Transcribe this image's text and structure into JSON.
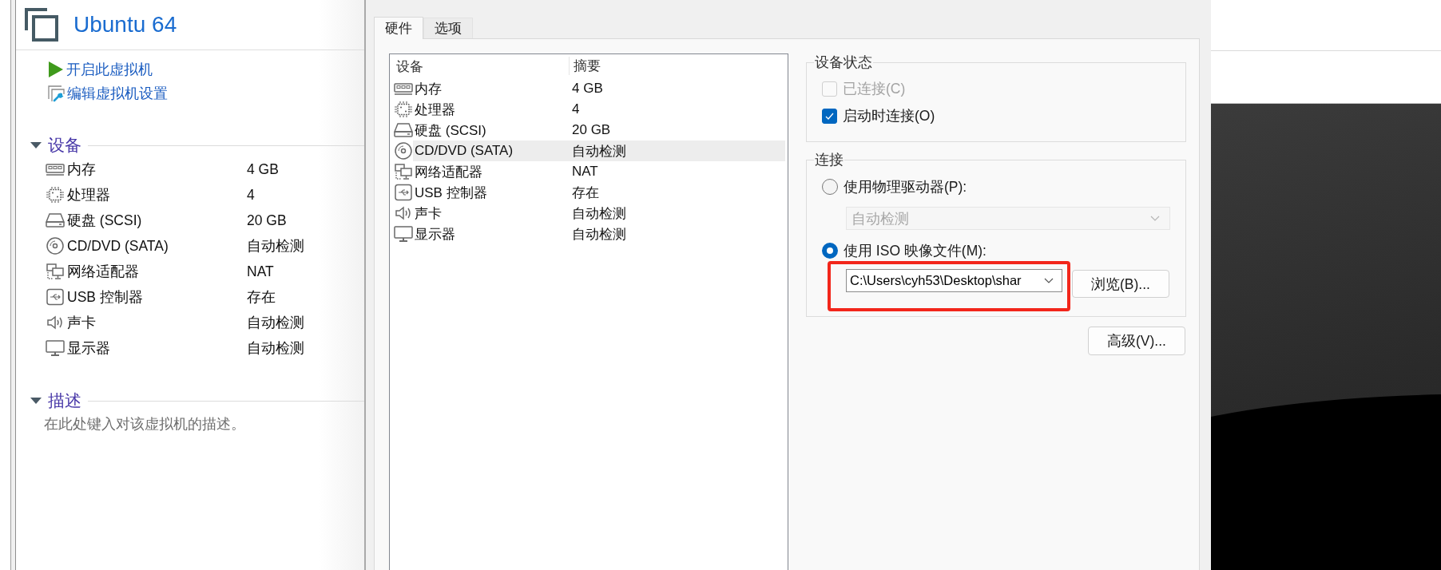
{
  "vm_panel": {
    "title": "Ubuntu 64",
    "actions": [
      {
        "kind": "power_on",
        "label": "开启此虚拟机"
      },
      {
        "kind": "edit_settings",
        "label": "编辑虚拟机设置"
      }
    ],
    "devices": {
      "title": "设备",
      "expanded": true,
      "items": [
        {
          "kind": "memory",
          "name": "内存",
          "summary": "4 GB"
        },
        {
          "kind": "processor",
          "name": "处理器",
          "summary": "4"
        },
        {
          "kind": "hard_disk",
          "name": "硬盘 (SCSI)",
          "summary": "20 GB"
        },
        {
          "kind": "cd_dvd",
          "name": "CD/DVD (SATA)",
          "summary": "自动检测"
        },
        {
          "kind": "network",
          "name": "网络适配器",
          "summary": "NAT"
        },
        {
          "kind": "usb",
          "name": "USB 控制器",
          "summary": "存在"
        },
        {
          "kind": "sound",
          "name": "声卡",
          "summary": "自动检测"
        },
        {
          "kind": "display",
          "name": "显示器",
          "summary": "自动检测"
        }
      ]
    },
    "description": {
      "title": "描述",
      "expanded": true,
      "hint": "在此处键入对该虚拟机的描述。"
    }
  },
  "settings_dialog": {
    "tabs": [
      {
        "label": "硬件",
        "selected": true
      },
      {
        "label": "选项",
        "selected": false
      }
    ],
    "hardware_list": {
      "columns": [
        "设备",
        "摘要"
      ],
      "rows": [
        {
          "kind": "memory",
          "device": "内存",
          "summary": "4 GB",
          "selected": false
        },
        {
          "kind": "processor",
          "device": "处理器",
          "summary": "4",
          "selected": false
        },
        {
          "kind": "hard_disk",
          "device": "硬盘 (SCSI)",
          "summary": "20 GB",
          "selected": false
        },
        {
          "kind": "cd_dvd",
          "device": "CD/DVD (SATA)",
          "summary": "自动检测",
          "selected": true
        },
        {
          "kind": "network",
          "device": "网络适配器",
          "summary": "NAT",
          "selected": false
        },
        {
          "kind": "usb",
          "device": "USB 控制器",
          "summary": "存在",
          "selected": false
        },
        {
          "kind": "sound",
          "device": "声卡",
          "summary": "自动检测",
          "selected": false
        },
        {
          "kind": "display",
          "device": "显示器",
          "summary": "自动检测",
          "selected": false
        }
      ]
    },
    "device_status": {
      "title": "设备状态",
      "options": [
        {
          "label": "已连接(C)",
          "checked": false,
          "disabled": true
        },
        {
          "label": "启动时连接(O)",
          "checked": true,
          "disabled": false
        }
      ]
    },
    "connection": {
      "title": "连接",
      "options": [
        {
          "kind": "physical_drive",
          "label": "使用物理驱动器(P):",
          "selected": false,
          "dropdown": {
            "value": "自动检测",
            "disabled": true
          }
        },
        {
          "kind": "iso_image",
          "label": "使用 ISO 映像文件(M):",
          "selected": true,
          "path": {
            "value": "C:\\Users\\cyh53\\Desktop\\shar",
            "highlighted": true
          },
          "browse_button": "浏览(B)..."
        }
      ]
    },
    "advanced_button": "高级(V)..."
  }
}
